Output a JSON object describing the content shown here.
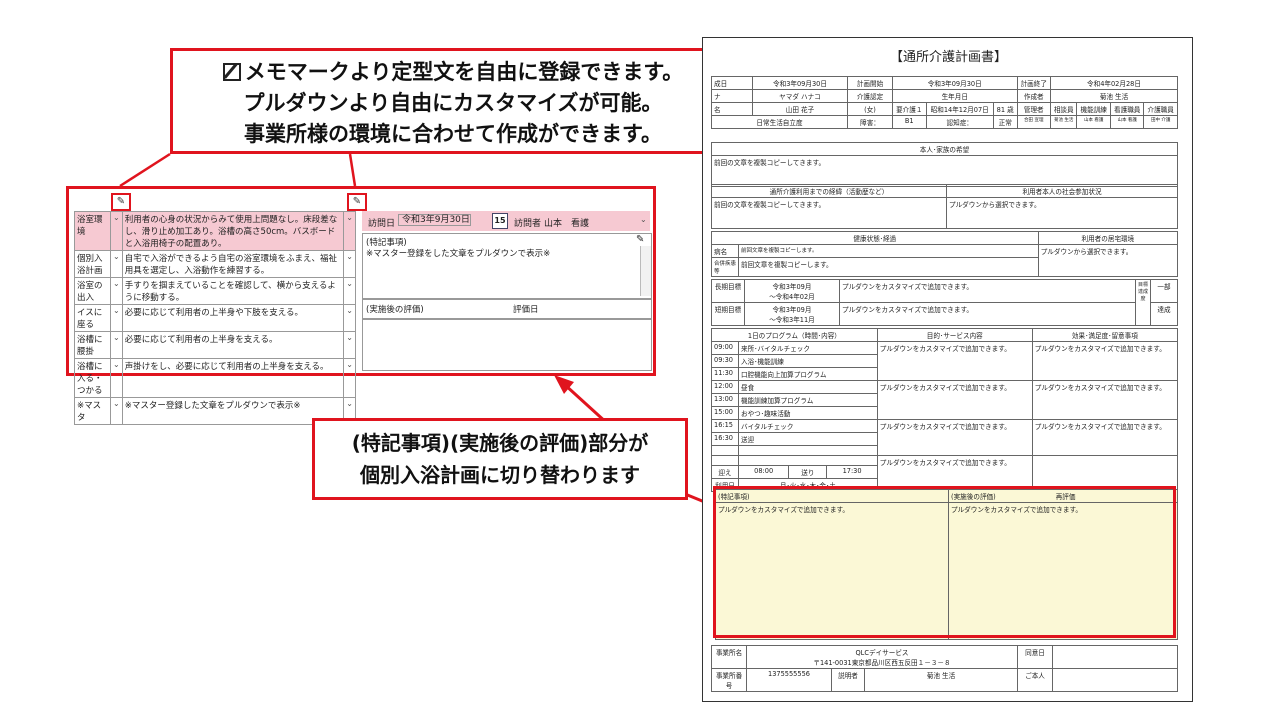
{
  "callouts": {
    "top": {
      "line1": "メモマークより定型文を自由に登録できます。",
      "line2": "プルダウンより自由にカスタマイズが可能。",
      "line3": "事業所様の環境に合わせて作成ができます。"
    },
    "bottom": {
      "line1": "(特記事項)(実施後の評価)部分が",
      "line2": "個別入浴計画に切り替わります"
    }
  },
  "panel": {
    "rows": [
      {
        "label": "浴室環境",
        "text": "利用者の心身の状況からみて使用上問題なし。床段差なし、滑り止め加工あり。浴槽の高さ50cm。バスボードと入浴用椅子の配置あり。"
      },
      {
        "label": "個別入浴計画",
        "text": "自宅で入浴ができるよう自宅の浴室環境をふまえ、福祉用具を選定し、入浴動作を練習する。"
      },
      {
        "label": "浴室の出入",
        "text": "手すりを掴まえていることを確認して、横から支えるように移動する。"
      },
      {
        "label": "イスに座る",
        "text": "必要に応じて利用者の上半身や下肢を支える。"
      },
      {
        "label": "浴槽に腰掛",
        "text": "必要に応じて利用者の上半身を支える。"
      },
      {
        "label": "浴槽に入る・つかる",
        "text": "声掛けをし、必要に応じて利用者の上半身を支える。"
      },
      {
        "label": "※マスタ",
        "text": "※マスター登録した文章をプルダウンで表示※"
      }
    ],
    "visit_date_label": "訪問日",
    "visit_date_value": "令和3年9月30日",
    "calendar_day": "15",
    "visitor_label": "訪問者",
    "visitor_value": "山本　看護",
    "special_label": "(特記事項)",
    "special_text": "※マスター登録をした文章をプルダウンで表示※",
    "eval_label": "(実施後の評価)",
    "eval_date_label": "評価日"
  },
  "doc": {
    "title": "【通所介護計画書】",
    "row1": [
      "成日",
      "令和3年09月30日",
      "計画開始",
      "令和3年09月30日",
      "計画終了",
      "令和4年02月28日"
    ],
    "row2": [
      "ナ",
      "ヤマダ ハナコ",
      "介護認定",
      "生年月日",
      "作成者",
      "菊池 生活"
    ],
    "row3": [
      "名",
      "山田 花子",
      "(女)",
      "要介護１",
      "昭和14年12月07日",
      "81 歳",
      "管理者",
      "相談員",
      "機能訓練",
      "看護職員",
      "介護職員"
    ],
    "row4": [
      "日常生活自立度",
      "障害：",
      "B1",
      "認知症：",
      "正常"
    ],
    "staff": [
      "合田 宣理",
      "菊池 生活",
      "山本 看護",
      "山本 看護",
      "田中 介護"
    ],
    "wish_header": "本人･家族の希望",
    "copy_prev": "前回の文章を複製コピーしてきます。",
    "history_header": "通所介護利用までの経緯（活動歴など）",
    "social_header": "利用者本人の社会参加状況",
    "pulldown_select": "プルダウンから選択できます。",
    "health_header": "健康状態･経過",
    "home_header": "利用者の居宅環境",
    "disease_label": "病名",
    "comorbid_label": "合併疾患等",
    "copy_prev_short": "前回文章を複製コピーします。",
    "long_goal": "長期目標",
    "short_goal": "短期目標",
    "long_period1": "令和3年09月",
    "long_period2": "～令和4年02月",
    "short_period1": "令和3年09月",
    "short_period2": "～令和3年11月",
    "custom_text": "プルダウンをカスタマイズで追加できます。",
    "achieve_label": "目標達成度",
    "achieve_long": "一部",
    "achieve_short": "達成",
    "program_header": "1日のプログラム（時間･内容）",
    "purpose_header": "目的･サービス内容",
    "effect_header": "効果･満足度･留意事項",
    "schedule": [
      {
        "time": "09:00",
        "item": "来所･バイタルチェック"
      },
      {
        "time": "09:30",
        "item": "入浴･機能訓練"
      },
      {
        "time": "11:30",
        "item": "口腔機能向上加算プログラム"
      },
      {
        "time": "12:00",
        "item": "昼食"
      },
      {
        "time": "13:00",
        "item": "機能訓練加算プログラム"
      },
      {
        "time": "15:00",
        "item": "おやつ･趣味活動"
      },
      {
        "time": "16:15",
        "item": "バイタルチェック"
      },
      {
        "time": "16:30",
        "item": "送迎"
      }
    ],
    "pickup_label": "迎え",
    "pickup_time": "08:00",
    "drop_label": "送り",
    "drop_time": "17:30",
    "days_label": "利用日",
    "days_value": "月･火･水･木･金･土",
    "special_header": "(特記事項)",
    "eval_header": "(実施後の評価)",
    "reeval_header": "再評価",
    "office_label": "事業所名",
    "office_name": "QLCデイサービス",
    "office_addr": "〒141-0031東京都品川区西五反田１－３－８",
    "agree_label": "同意日",
    "office_no_label": "事業所番号",
    "office_no": "1375555556",
    "explainer_label": "説明者",
    "explainer": "菊池 生活",
    "self_label": "ご本人"
  }
}
